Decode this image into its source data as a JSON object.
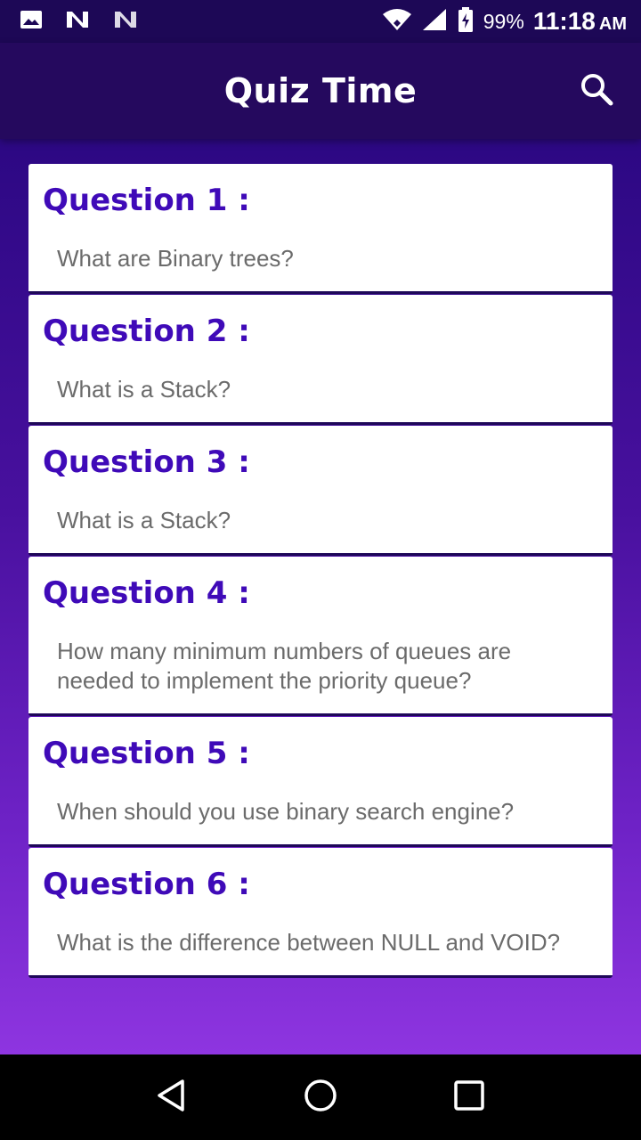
{
  "status_bar": {
    "icons": [
      "image-icon",
      "n-notification-icon",
      "n-notification-icon",
      "wifi-icon",
      "signal-icon",
      "battery-charging-icon"
    ],
    "battery": "99%",
    "time": "11:18",
    "ampm": "AM"
  },
  "app_bar": {
    "title": "Quiz Time",
    "search_icon": "search-icon"
  },
  "questions": [
    {
      "title": "Question 1 :",
      "text": "What are Binary trees?"
    },
    {
      "title": "Question 2 :",
      "text": "What is a Stack?"
    },
    {
      "title": "Question 3 :",
      "text": "What is a Stack?"
    },
    {
      "title": "Question 4 :",
      "text": "How many minimum numbers of queues are needed to implement the priority queue?"
    },
    {
      "title": "Question 5 :",
      "text": "When should you use binary search engine?"
    },
    {
      "title": "Question 6 :",
      "text": "What is the difference between NULL and VOID?"
    }
  ],
  "nav_bar": {
    "icons": [
      "back-icon",
      "home-icon",
      "recents-icon"
    ]
  },
  "colors": {
    "app_bar": "#25095e",
    "status_bar": "#1d0856",
    "question_title": "#3f0ab8",
    "gradient_top": "#2c0883",
    "gradient_bottom": "#8e35e0"
  }
}
